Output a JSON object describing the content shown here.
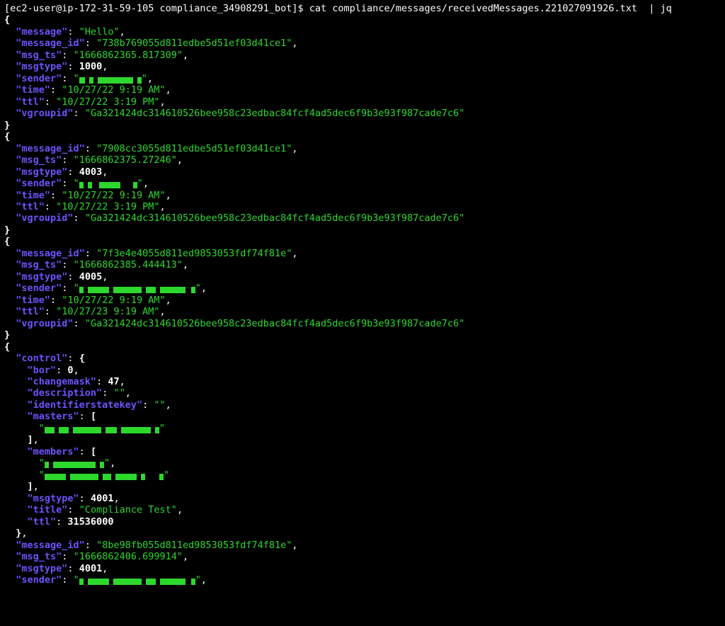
{
  "prompt": {
    "user_host": "[ec2-user@ip-172-31-59-105 compliance_34908291_bot]$",
    "command": "cat compliance/messages/receivedMessages.221027091926.txt  | jq"
  },
  "records": [
    {
      "fields": [
        {
          "key": "message",
          "type": "string",
          "value": "Hello"
        },
        {
          "key": "message_id",
          "type": "string",
          "value": "738b769055d811edbe5d51ef03d41ce1"
        },
        {
          "key": "msg_ts",
          "type": "string",
          "value": "1666862365.817309"
        },
        {
          "key": "msgtype",
          "type": "number",
          "value": "1000"
        },
        {
          "key": "sender",
          "type": "redacted",
          "pattern": [
            8,
            6,
            6,
            6,
            50,
            6,
            6
          ]
        },
        {
          "key": "time",
          "type": "string",
          "value": "10/27/22 9:19 AM"
        },
        {
          "key": "ttl",
          "type": "string",
          "value": "10/27/22 3:19 PM"
        },
        {
          "key": "vgroupid",
          "type": "string",
          "value": "Ga321424dc314610526bee958c23edbac84fcf4ad5dec6f9b3e93f987cade7c6"
        }
      ]
    },
    {
      "fields": [
        {
          "key": "message_id",
          "type": "string",
          "value": "7908cc3055d811edbe5d51ef03d41ce1"
        },
        {
          "key": "msg_ts",
          "type": "string",
          "value": "1666862375.27246"
        },
        {
          "key": "msgtype",
          "type": "number",
          "value": "4003"
        },
        {
          "key": "sender",
          "type": "redacted",
          "pattern": [
            6,
            6,
            6,
            10,
            30,
            18,
            6
          ]
        },
        {
          "key": "time",
          "type": "string",
          "value": "10/27/22 9:19 AM"
        },
        {
          "key": "ttl",
          "type": "string",
          "value": "10/27/22 3:19 PM"
        },
        {
          "key": "vgroupid",
          "type": "string",
          "value": "Ga321424dc314610526bee958c23edbac84fcf4ad5dec6f9b3e93f987cade7c6"
        }
      ]
    },
    {
      "fields": [
        {
          "key": "message_id",
          "type": "string",
          "value": "7f3e4e4055d811ed9853053fdf74f81e"
        },
        {
          "key": "msg_ts",
          "type": "string",
          "value": "1666862385.444413"
        },
        {
          "key": "msgtype",
          "type": "number",
          "value": "4005"
        },
        {
          "key": "sender",
          "type": "redacted",
          "pattern": [
            6,
            6,
            30,
            6,
            40,
            6,
            14,
            6,
            36,
            8,
            6
          ]
        },
        {
          "key": "time",
          "type": "string",
          "value": "10/27/22 9:19 AM"
        },
        {
          "key": "ttl",
          "type": "string",
          "value": "10/27/23 9:19 AM"
        },
        {
          "key": "vgroupid",
          "type": "string",
          "value": "Ga321424dc314610526bee958c23edbac84fcf4ad5dec6f9b3e93f987cade7c6"
        }
      ]
    },
    {
      "control": {
        "bor": "0",
        "changemask": "47",
        "description": "",
        "identifierstatekey": "",
        "masters_pattern": [
          [
            14,
            6,
            14,
            6,
            40,
            6,
            16,
            6,
            42,
            6,
            6
          ]
        ],
        "members_patterns": [
          [
            6,
            6,
            60,
            6,
            6
          ],
          [
            30,
            6,
            40,
            6,
            12,
            6,
            30,
            6,
            6,
            20,
            6
          ]
        ],
        "msgtype": "4001",
        "title": "Compliance Test",
        "ttl": "31536000"
      },
      "fields_after": [
        {
          "key": "message_id",
          "type": "string",
          "value": "8be98fb055d811ed9853053fdf74f81e"
        },
        {
          "key": "msg_ts",
          "type": "string",
          "value": "1666862406.699914"
        },
        {
          "key": "msgtype",
          "type": "number",
          "value": "4001"
        },
        {
          "key": "sender",
          "type": "redacted",
          "pattern": [
            6,
            6,
            30,
            6,
            40,
            6,
            14,
            6,
            36,
            8,
            6
          ],
          "trailing": false
        }
      ]
    }
  ]
}
